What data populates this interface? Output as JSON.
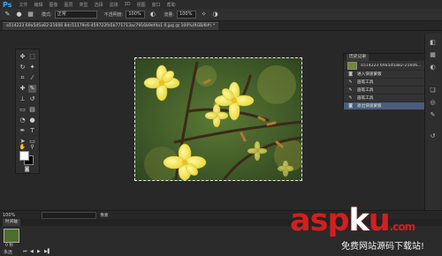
{
  "app": {
    "logo": "Ps"
  },
  "menu": {
    "items": [
      "文件",
      "编辑",
      "图像",
      "图层",
      "类型",
      "选择",
      "滤镜",
      "3D",
      "视图",
      "窗口",
      "帮助"
    ]
  },
  "options_bar": {
    "brush_size": "19",
    "mode_label": "模式:",
    "mode_value": "正常",
    "opacity_label": "不透明度:",
    "opacity_value": "100%",
    "flow_label": "流量:",
    "flow_value": "100%"
  },
  "document_tab": {
    "title": "a514223 69a5d5a82-21606 8dc51179c6-459722fa5b771713ac7916b9ef4a1 0.jpg @ 100%(RGB/8#) *"
  },
  "history_panel": {
    "tabs": [
      "历史记录"
    ],
    "snapshot_label": "a514223 69a5d5a82-21606...",
    "items": [
      {
        "label": "进入快速蒙版",
        "icon": "quickmask-icon",
        "active": false
      },
      {
        "label": "画笔工具",
        "icon": "brush-icon",
        "active": false
      },
      {
        "label": "画笔工具",
        "icon": "brush-icon",
        "active": false
      },
      {
        "label": "画笔工具",
        "icon": "brush-icon",
        "active": false
      },
      {
        "label": "退出快速蒙版",
        "icon": "quickmask-icon",
        "active": true
      }
    ]
  },
  "status": {
    "zoom": "100%",
    "unit": "像素"
  },
  "timeline": {
    "tab": "时间轴",
    "frame_time": "0 秒",
    "loop": "永远"
  },
  "watermark": {
    "main_left": "asp",
    "main_k": "k",
    "main_right": "u",
    "suffix": ".com",
    "sub": "免费网站源码下载站!"
  },
  "colors": {
    "accent": "#31a8ff",
    "selection": "#4a5d7a",
    "watermark": "#d31f1f"
  }
}
